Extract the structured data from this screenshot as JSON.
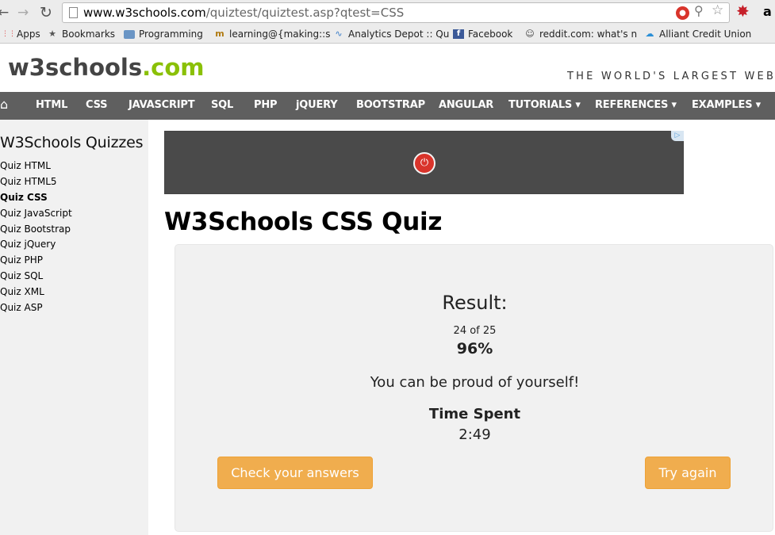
{
  "browser": {
    "url_host": "www.w3schools.com",
    "url_path": "/quiztest/quiztest.asp?qtest=CSS",
    "extension_amazon": "a",
    "bookmarks": [
      {
        "label": "Apps",
        "icon": "apps-grid-icon"
      },
      {
        "label": "Bookmarks",
        "icon": "star-icon"
      },
      {
        "label": "Programming",
        "icon": "folder-icon"
      },
      {
        "label": "learning@{making::s",
        "icon": "favicon-icon"
      },
      {
        "label": "Analytics Depot :: Qu",
        "icon": "chart-line-icon"
      },
      {
        "label": "Facebook",
        "icon": "facebook-icon"
      },
      {
        "label": "reddit.com: what's n",
        "icon": "reddit-icon"
      },
      {
        "label": "Alliant Credit Union",
        "icon": "cloud-icon"
      }
    ]
  },
  "header": {
    "logo_part1": "w3schools",
    "logo_part2": ".com",
    "slogan": "THE WORLD'S LARGEST WEB"
  },
  "topnav": [
    "HTML",
    "CSS",
    "JAVASCRIPT",
    "SQL",
    "PHP",
    "jQUERY",
    "BOOTSTRAP",
    "ANGULAR",
    "TUTORIALS ▾",
    "REFERENCES ▾",
    "EXAMPLES ▾"
  ],
  "sidebar": {
    "title": "W3Schools Quizzes",
    "items": [
      {
        "label": "Quiz HTML",
        "active": false
      },
      {
        "label": "Quiz HTML5",
        "active": false
      },
      {
        "label": "Quiz CSS",
        "active": true
      },
      {
        "label": "Quiz JavaScript",
        "active": false
      },
      {
        "label": "Quiz Bootstrap",
        "active": false
      },
      {
        "label": "Quiz jQuery",
        "active": false
      },
      {
        "label": "Quiz PHP",
        "active": false
      },
      {
        "label": "Quiz SQL",
        "active": false
      },
      {
        "label": "Quiz XML",
        "active": false
      },
      {
        "label": "Quiz ASP",
        "active": false
      }
    ]
  },
  "main": {
    "title": "W3Schools CSS Quiz",
    "result": {
      "heading": "Result:",
      "score": "24 of 25",
      "percent": "96%",
      "message": "You can be proud of yourself!",
      "time_label": "Time Spent",
      "time_value": "2:49"
    },
    "buttons": {
      "check": "Check your answers",
      "again": "Try again"
    }
  },
  "colors": {
    "logo_green": "#8ac007",
    "nav_bg": "#5f5f5f",
    "button_orange": "#f0ad4e"
  }
}
